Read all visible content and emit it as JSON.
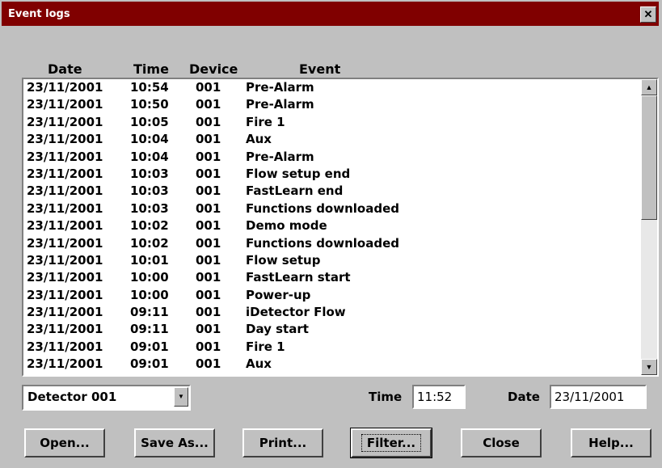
{
  "window": {
    "title": "Event logs",
    "close_glyph": "✕"
  },
  "columns": {
    "date": "Date",
    "time": "Time",
    "device": "Device",
    "event": "Event"
  },
  "rows": [
    {
      "date": "23/11/2001",
      "time": "10:54",
      "device": "001",
      "event": "Pre-Alarm"
    },
    {
      "date": "23/11/2001",
      "time": "10:50",
      "device": "001",
      "event": "Pre-Alarm"
    },
    {
      "date": "23/11/2001",
      "time": "10:05",
      "device": "001",
      "event": "Fire 1"
    },
    {
      "date": "23/11/2001",
      "time": "10:04",
      "device": "001",
      "event": "Aux"
    },
    {
      "date": "23/11/2001",
      "time": "10:04",
      "device": "001",
      "event": "Pre-Alarm"
    },
    {
      "date": "23/11/2001",
      "time": "10:03",
      "device": "001",
      "event": "Flow setup end"
    },
    {
      "date": "23/11/2001",
      "time": "10:03",
      "device": "001",
      "event": "FastLearn end"
    },
    {
      "date": "23/11/2001",
      "time": "10:03",
      "device": "001",
      "event": "Functions downloaded"
    },
    {
      "date": "23/11/2001",
      "time": "10:02",
      "device": "001",
      "event": "Demo mode"
    },
    {
      "date": "23/11/2001",
      "time": "10:02",
      "device": "001",
      "event": "Functions downloaded"
    },
    {
      "date": "23/11/2001",
      "time": "10:01",
      "device": "001",
      "event": "Flow setup"
    },
    {
      "date": "23/11/2001",
      "time": "10:00",
      "device": "001",
      "event": "FastLearn start"
    },
    {
      "date": "23/11/2001",
      "time": "10:00",
      "device": "001",
      "event": "Power-up"
    },
    {
      "date": "23/11/2001",
      "time": "09:11",
      "device": "001",
      "event": "iDetector   Flow"
    },
    {
      "date": "23/11/2001",
      "time": "09:11",
      "device": "001",
      "event": "Day start"
    },
    {
      "date": "23/11/2001",
      "time": "09:01",
      "device": "001",
      "event": "Fire 1"
    },
    {
      "date": "23/11/2001",
      "time": "09:01",
      "device": "001",
      "event": "Aux"
    }
  ],
  "scrollbar": {
    "up_glyph": "▲",
    "down_glyph": "▼"
  },
  "detector_select": {
    "value": "Detector 001",
    "arrow_glyph": "▼"
  },
  "time_field": {
    "label": "Time",
    "value": "11:52"
  },
  "date_field": {
    "label": "Date",
    "value": "23/11/2001"
  },
  "buttons": {
    "open": "Open...",
    "save_as": "Save As...",
    "print": "Print...",
    "filter": "Filter...",
    "close": "Close",
    "help": "Help..."
  },
  "colors": {
    "titlebar": "#800000",
    "face": "#c0c0c0",
    "list_bg": "#ffffff"
  }
}
